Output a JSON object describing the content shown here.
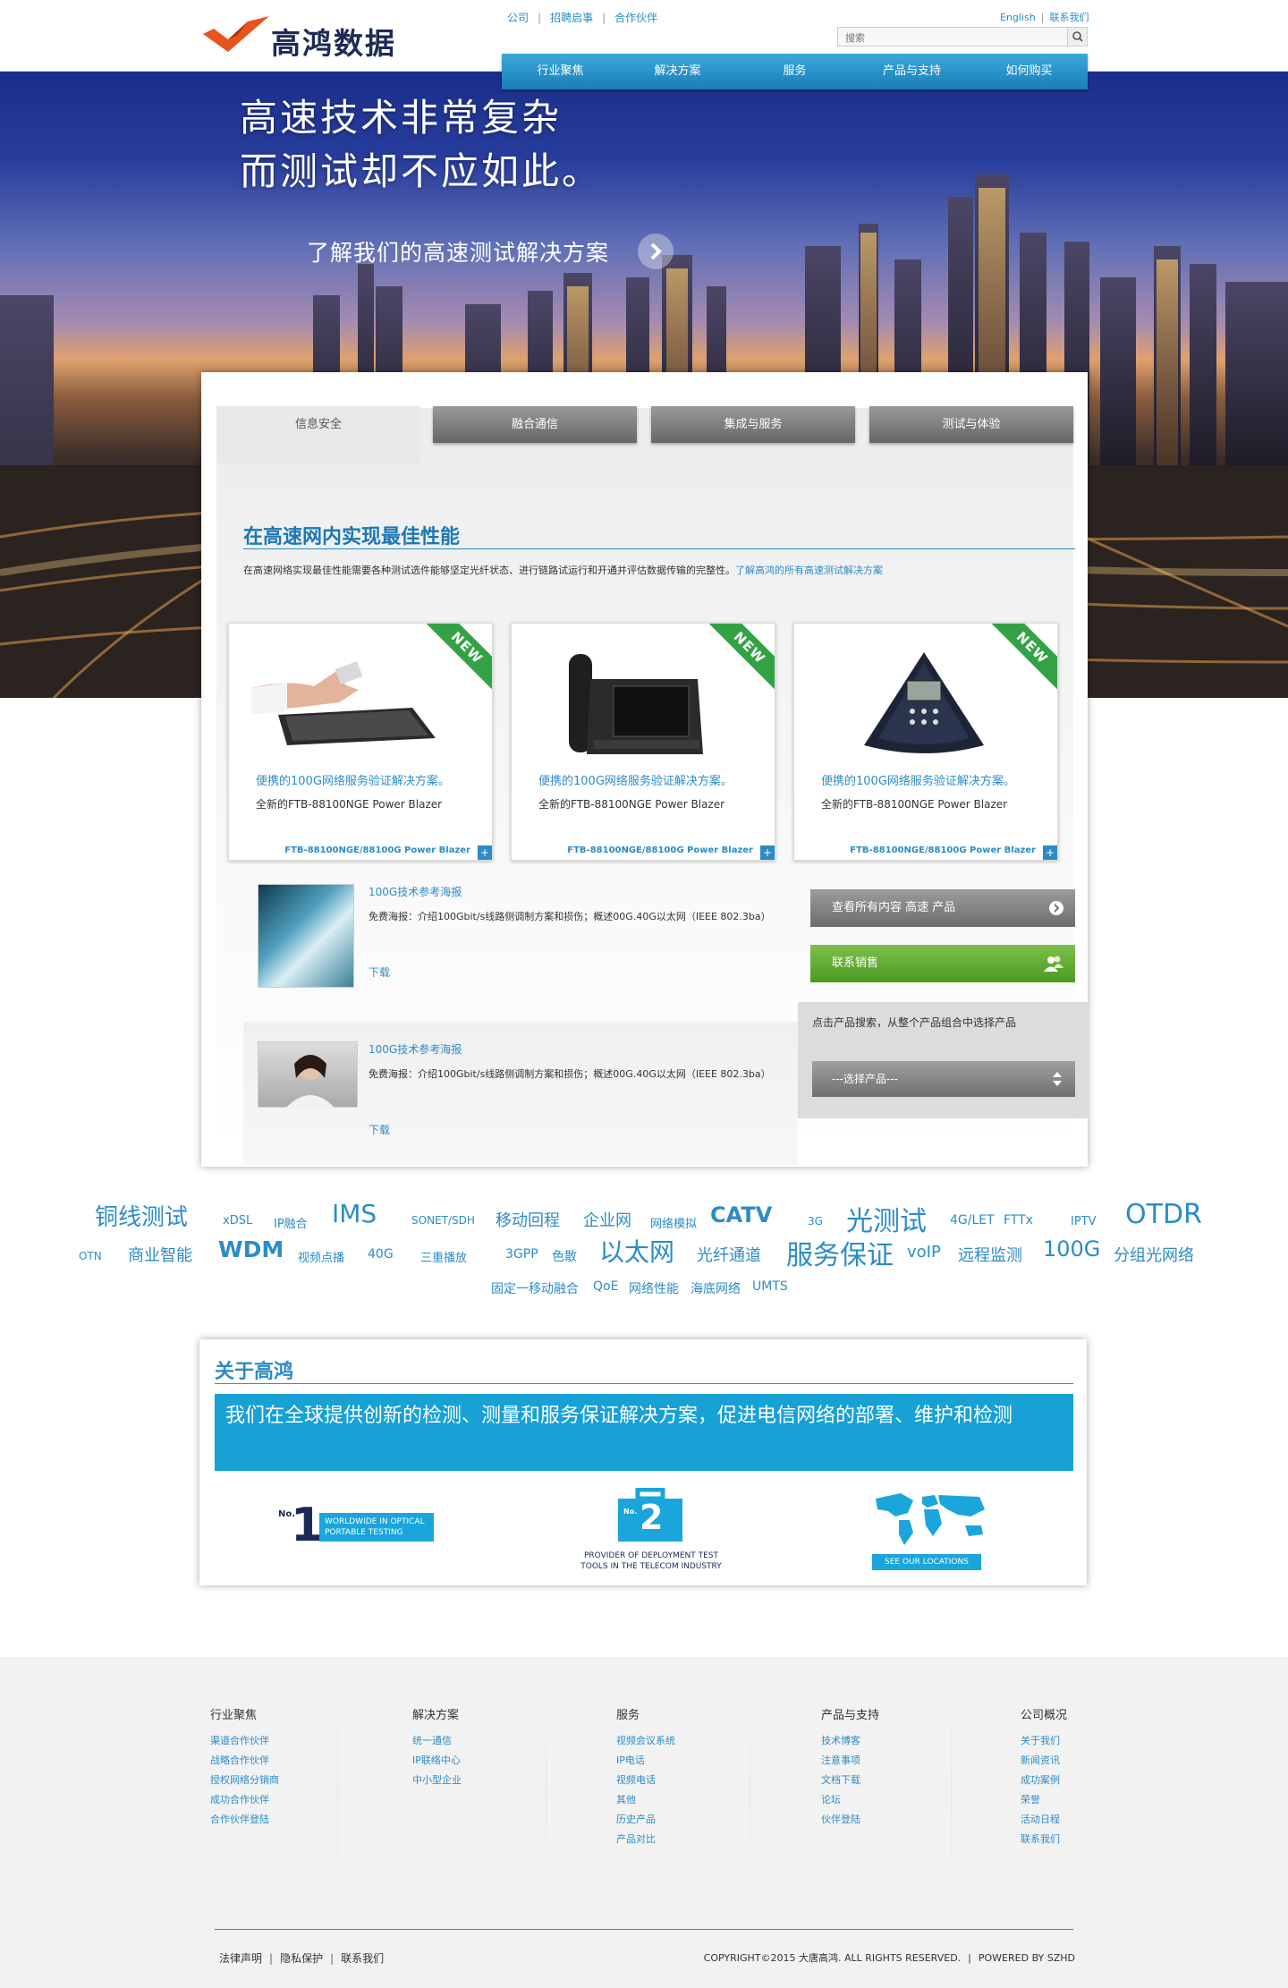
{
  "header": {
    "logo_text": "高鸿数据",
    "top_links": [
      "公司",
      "招聘启事",
      "合作伙伴"
    ],
    "lang_link": "English",
    "contact_link": "联系我们",
    "search_placeholder": "搜索"
  },
  "nav": {
    "items": [
      "行业聚焦",
      "解决方案",
      "服务",
      "产品与支持",
      "如何购买"
    ]
  },
  "hero": {
    "line1": "高速技术非常复杂",
    "line2": "而测试却不应如此。",
    "sub": "了解我们的高速测试解决方案"
  },
  "tabs": {
    "items": [
      "信息安全",
      "融合通信",
      "集成与服务",
      "测试与体验"
    ],
    "active": "信息安全"
  },
  "section": {
    "title": "在高速网内实现最佳性能",
    "desc": "在高速网络实现最佳性能需要各种测试选件能够坚定光纤状态、进行链路试运行和开通并评估数据传输的完整性。",
    "desc_link": "了解高鸿的所有高速测试解决方案"
  },
  "cards": [
    {
      "badge": "NEW",
      "title": "便携的100G网络服务验证解决方案。",
      "sub": "全新的FTB-88100NGE Power Blazer",
      "foot": "FTB-88100NGE/88100G Power Blazer",
      "plus": "+"
    },
    {
      "badge": "NEW",
      "title": "便携的100G网络服务验证解决方案。",
      "sub": "全新的FTB-88100NGE Power Blazer",
      "foot": "FTB-88100NGE/88100G Power Blazer",
      "plus": "+"
    },
    {
      "badge": "NEW",
      "title": "便携的100G网络服务验证解决方案。",
      "sub": "全新的FTB-88100NGE Power Blazer",
      "foot": "FTB-88100NGE/88100G Power Blazer",
      "plus": "+"
    }
  ],
  "resources": [
    {
      "title": "100G技术参考海报",
      "desc": "免费海报：介绍100Gbit/s线路侧调制方案和损伤；概述00G.40G以太网（IEEE 802.3ba）",
      "download": "下载"
    },
    {
      "title": "100G技术参考海报",
      "desc": "免费海报：介绍100Gbit/s线路侧调制方案和损伤；概述00G.40G以太网（IEEE 802.3ba）",
      "download": "下载"
    }
  ],
  "sidebar": {
    "view_all": "查看所有内容 高速 产品",
    "contact_sales": "联系销售",
    "product_hint": "点击产品搜索，从整个产品组合中选择产品",
    "product_select": "---选择产品---"
  },
  "tags": [
    "铜线测试",
    "xDSL",
    "IP融合",
    "IMS",
    "SONET/SDH",
    "移动回程",
    "企业网",
    "网络模拟",
    "CATV",
    "3G",
    "光测试",
    "4G/LET",
    "FTTx",
    "IPTV",
    "OTDR",
    "OTN",
    "商业智能",
    "WDM",
    "视频点播",
    "40G",
    "三重播放",
    "3GPP",
    "色散",
    "以太网",
    "光纤通道",
    "服务保证",
    "voIP",
    "远程监测",
    "100G",
    "分组光网络",
    "固定一移动融合",
    "QoE",
    "网络性能",
    "海底网络",
    "UMTS"
  ],
  "about": {
    "title": "关于高鸿",
    "banner": "我们在全球提供创新的检测、测量和服务保证解决方案，促进电信网络的部署、维护和检测",
    "badge1_no": "No.",
    "badge1_num": "1",
    "badge1_line1": "WORLDWIDE IN OPTICAL",
    "badge1_line2": "PORTABLE TESTING",
    "badge2_no": "No.",
    "badge2_num": "2",
    "badge2_line1": "PROVIDER OF DEPLOYMENT TEST",
    "badge2_line2": "TOOLS IN THE TELECOM INDUSTRY",
    "badge3_label": "SEE OUR LOCATIONS"
  },
  "footer": {
    "columns": [
      {
        "heading": "行业聚焦",
        "links": [
          "渠道合作伙伴",
          "战略合作伙伴",
          "授权网络分销商",
          "成功合作伙伴",
          "合作伙伴登陆"
        ]
      },
      {
        "heading": "解决方案",
        "links": [
          "统一通信",
          "IP联络中心",
          "中小型企业"
        ]
      },
      {
        "heading": "服务",
        "links": [
          "视频会议系统",
          "IP电话",
          "视频电话",
          "其他",
          "历史产品",
          "产品对比"
        ]
      },
      {
        "heading": "产品与支持",
        "links": [
          "技术博客",
          "注意事项",
          "文档下载",
          "论坛",
          "伙伴登陆"
        ]
      },
      {
        "heading": "公司概况",
        "links": [
          "关于我们",
          "新闻资讯",
          "成功案例",
          "荣誉",
          "活动日程",
          "联系我们"
        ]
      }
    ],
    "legal": [
      "法律声明",
      "隐私保护",
      "联系我们"
    ],
    "copyright": "COPYRIGHT©2015 大唐高鸿. ALL RIGHTS RESERVED.",
    "powered": "POWERED BY SZHD"
  },
  "colors": {
    "brand_blue": "#2b8cc7",
    "nav_blue": "#1a7db8",
    "new_green": "#33a244",
    "sales_green": "#5aa82c",
    "logo_orange": "#e8541e",
    "logo_navy": "#1c2a55"
  }
}
